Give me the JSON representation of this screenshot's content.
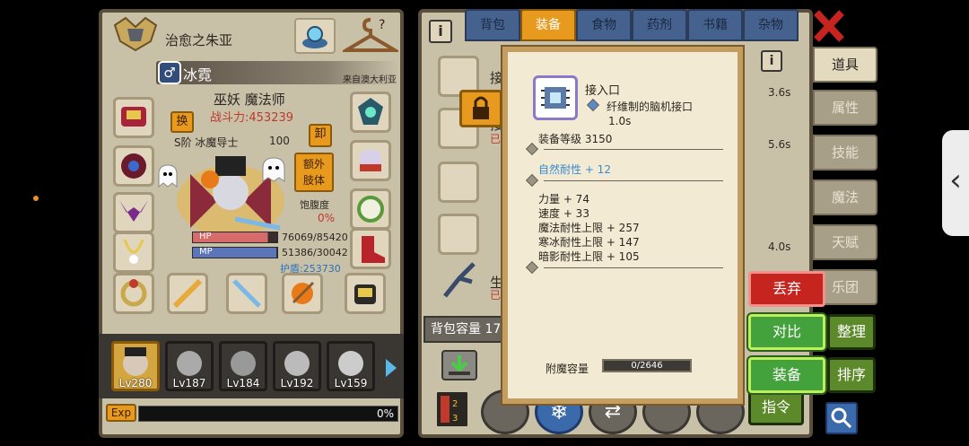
{
  "character": {
    "title": "治愈之朱亚",
    "name": "冰霓",
    "origin": "来自澳大利亚",
    "class": "巫妖 魔法师",
    "power": "战斗力:453239",
    "subclass": "S阶 冰魔导士",
    "level_badge": "100",
    "swap": "换",
    "unequip": "卸",
    "extra_body": "额外\n肢体",
    "satiety_label": "饱腹度",
    "satiety_value": "0%",
    "hp_label": "HP",
    "hp_value": "76069/85420",
    "hp_ratio": 0.89,
    "mp_label": "MP",
    "mp_value": "51386/30042",
    "shield": "护盾:253730",
    "exp_label": "Exp",
    "exp_value": "0%"
  },
  "party": [
    {
      "level": "Lv280"
    },
    {
      "level": "Lv187"
    },
    {
      "level": "Lv184"
    },
    {
      "level": "Lv192"
    },
    {
      "level": "Lv159"
    }
  ],
  "tabs": [
    "背包",
    "装备",
    "食物",
    "药剂",
    "书籍",
    "杂物"
  ],
  "active_tab": "装备",
  "side_tabs": [
    "道具",
    "属性",
    "技能",
    "魔法",
    "天赋",
    "乐团"
  ],
  "inventory": {
    "rows": [
      {
        "name": "接",
        "time": "3.6s"
      },
      {
        "name": "接",
        "tag": "已",
        "time": "5.6s"
      },
      {
        "name": "",
        "time": ""
      },
      {
        "name": "",
        "time": "4.0s"
      },
      {
        "name": "生",
        "tag": "已",
        "time": ""
      }
    ],
    "capacity": "背包容量 17"
  },
  "tooltip": {
    "name": "接入口",
    "subtitle": "纤维制的脑机接口",
    "time": "1.0s",
    "equip_level": "装备等级 3150",
    "natural": "自然耐性 + 12",
    "stats": [
      "力量 + 74",
      "速度 + 33",
      "魔法耐性上限 + 257",
      "寒冰耐性上限 + 147",
      "暗影耐性上限 + 105"
    ],
    "ench_label": "附魔容量",
    "ench_value": "0/2646"
  },
  "actions": {
    "discard": "丢弃",
    "compare": "对比",
    "equip": "装备",
    "sort": "整理",
    "order": "排序",
    "command": "指令"
  },
  "icons": {
    "info": "info-icon",
    "close": "close-x-icon",
    "search": "search-icon",
    "lock": "lock-icon",
    "arrow": "chevron-right-icon",
    "handle": "chevron-left-icon"
  },
  "colors": {
    "accent": "#e89a1f",
    "green": "#43a23b",
    "red": "#c6251f",
    "panel": "#c9c0a8"
  }
}
